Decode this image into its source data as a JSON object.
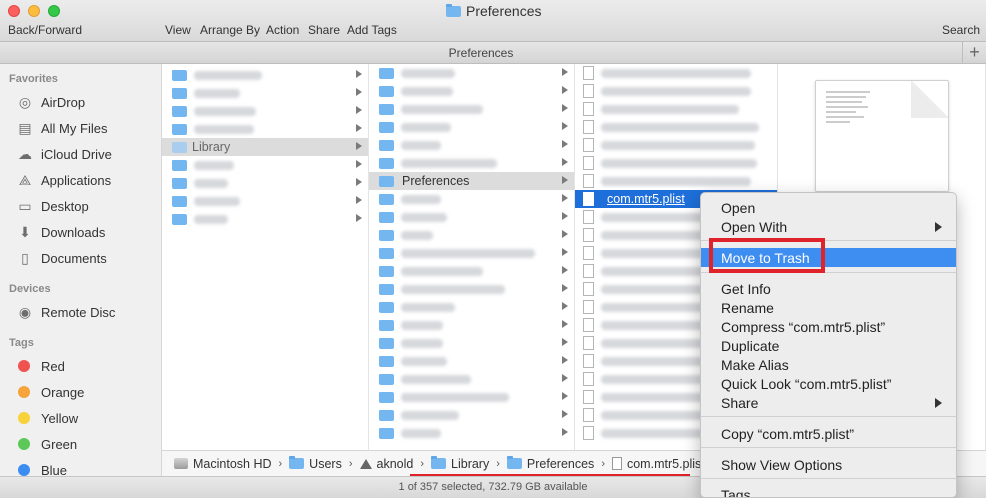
{
  "window": {
    "title": "Preferences"
  },
  "toolbar": {
    "back_forward": "Back/Forward",
    "view": "View",
    "arrange_by": "Arrange By",
    "action": "Action",
    "share": "Share",
    "add_tags": "Add Tags",
    "search": "Search"
  },
  "path_header": {
    "title": "Preferences",
    "add_icon": "plus-icon"
  },
  "sidebar": {
    "favorites_heading": "Favorites",
    "favorites": [
      {
        "label": "AirDrop",
        "icon": "airdrop-icon"
      },
      {
        "label": "All My Files",
        "icon": "all-files-icon"
      },
      {
        "label": "iCloud Drive",
        "icon": "cloud-icon"
      },
      {
        "label": "Applications",
        "icon": "applications-icon"
      },
      {
        "label": "Desktop",
        "icon": "desktop-icon"
      },
      {
        "label": "Downloads",
        "icon": "downloads-icon"
      },
      {
        "label": "Documents",
        "icon": "documents-icon"
      }
    ],
    "devices_heading": "Devices",
    "devices": [
      {
        "label": "Remote Disc",
        "icon": "disc-icon"
      }
    ],
    "tags_heading": "Tags",
    "tags": [
      {
        "label": "Red",
        "color": "#f0524f"
      },
      {
        "label": "Orange",
        "color": "#f5a33a"
      },
      {
        "label": "Yellow",
        "color": "#f8d23a"
      },
      {
        "label": "Green",
        "color": "#5dc858"
      },
      {
        "label": "Blue",
        "color": "#3b8df2"
      }
    ]
  },
  "column1": {
    "selected_label": "Library"
  },
  "column2": {
    "selected_label": "Preferences"
  },
  "column3": {
    "selected_label": "com.mtr5.plist"
  },
  "pathbar": {
    "crumbs": [
      "Macintosh HD",
      "Users",
      "aknold",
      "Library",
      "Preferences",
      "com.mtr5.plist"
    ]
  },
  "status": {
    "text": "1 of 357 selected, 732.79 GB available"
  },
  "context_menu": {
    "open": "Open",
    "open_with": "Open With",
    "move_to_trash": "Move to Trash",
    "get_info": "Get Info",
    "rename": "Rename",
    "compress": "Compress “com.mtr5.plist”",
    "duplicate": "Duplicate",
    "make_alias": "Make Alias",
    "quick_look": "Quick Look “com.mtr5.plist”",
    "share": "Share",
    "copy": "Copy “com.mtr5.plist”",
    "show_view_options": "Show View Options",
    "tags": "Tags..."
  },
  "colors": {
    "highlight": "#3d8ef0",
    "selection": "#1e6fd9",
    "annotation_red": "#e0232b"
  }
}
